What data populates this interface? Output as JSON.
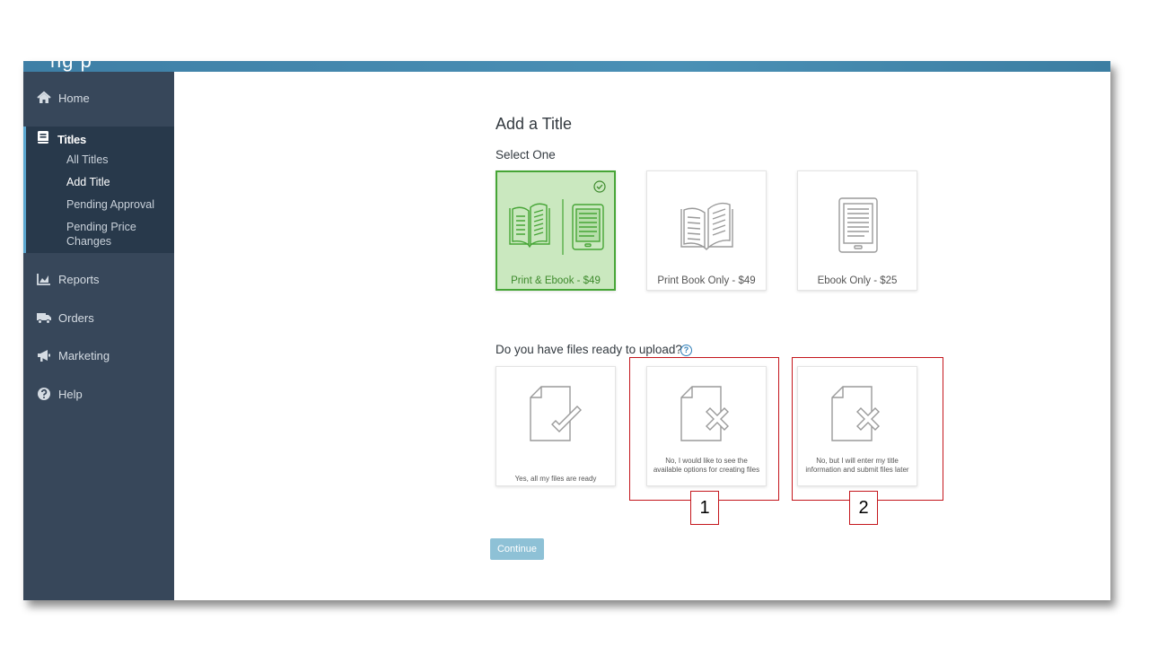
{
  "header": {
    "brand_fragment": "ng    p"
  },
  "sidebar": {
    "items": [
      {
        "label": "Home",
        "icon": "home-icon"
      },
      {
        "label": "Reports",
        "icon": "chart-icon"
      },
      {
        "label": "Orders",
        "icon": "truck-icon"
      },
      {
        "label": "Marketing",
        "icon": "megaphone-icon"
      },
      {
        "label": "Help",
        "icon": "question-icon"
      }
    ],
    "titles": {
      "label": "Titles",
      "icon": "book-icon",
      "subitems": [
        "All Titles",
        "Add Title",
        "Pending Approval",
        "Pending Price Changes"
      ],
      "active_subitem": "Add Title"
    }
  },
  "main": {
    "title": "Add a Title",
    "select_label": "Select One",
    "format_options": [
      {
        "label": "Print & Ebook - $49",
        "selected": true
      },
      {
        "label": "Print Book Only - $49",
        "selected": false
      },
      {
        "label": "Ebook Only - $25",
        "selected": false
      }
    ],
    "files_question": "Do you have files ready to upload?",
    "help_symbol": "?",
    "file_options": [
      {
        "label": "Yes, all my files are ready",
        "icon": "document-check-icon"
      },
      {
        "label": "No, I would like to see the available options for creating files",
        "icon": "document-x-icon"
      },
      {
        "label": "No, but I will enter my title information and submit files later",
        "icon": "document-x-icon"
      }
    ],
    "continue_label": "Continue"
  },
  "annotations": [
    "1",
    "2"
  ],
  "colors": {
    "sidebar_bg": "#37475a",
    "sidebar_active_bg": "#28394b",
    "topbar": "#4a90b5",
    "selected_fill": "#cae8bf",
    "selected_border": "#46a536",
    "callout_red": "#c4161c",
    "continue_bg": "#8ec1d6"
  }
}
